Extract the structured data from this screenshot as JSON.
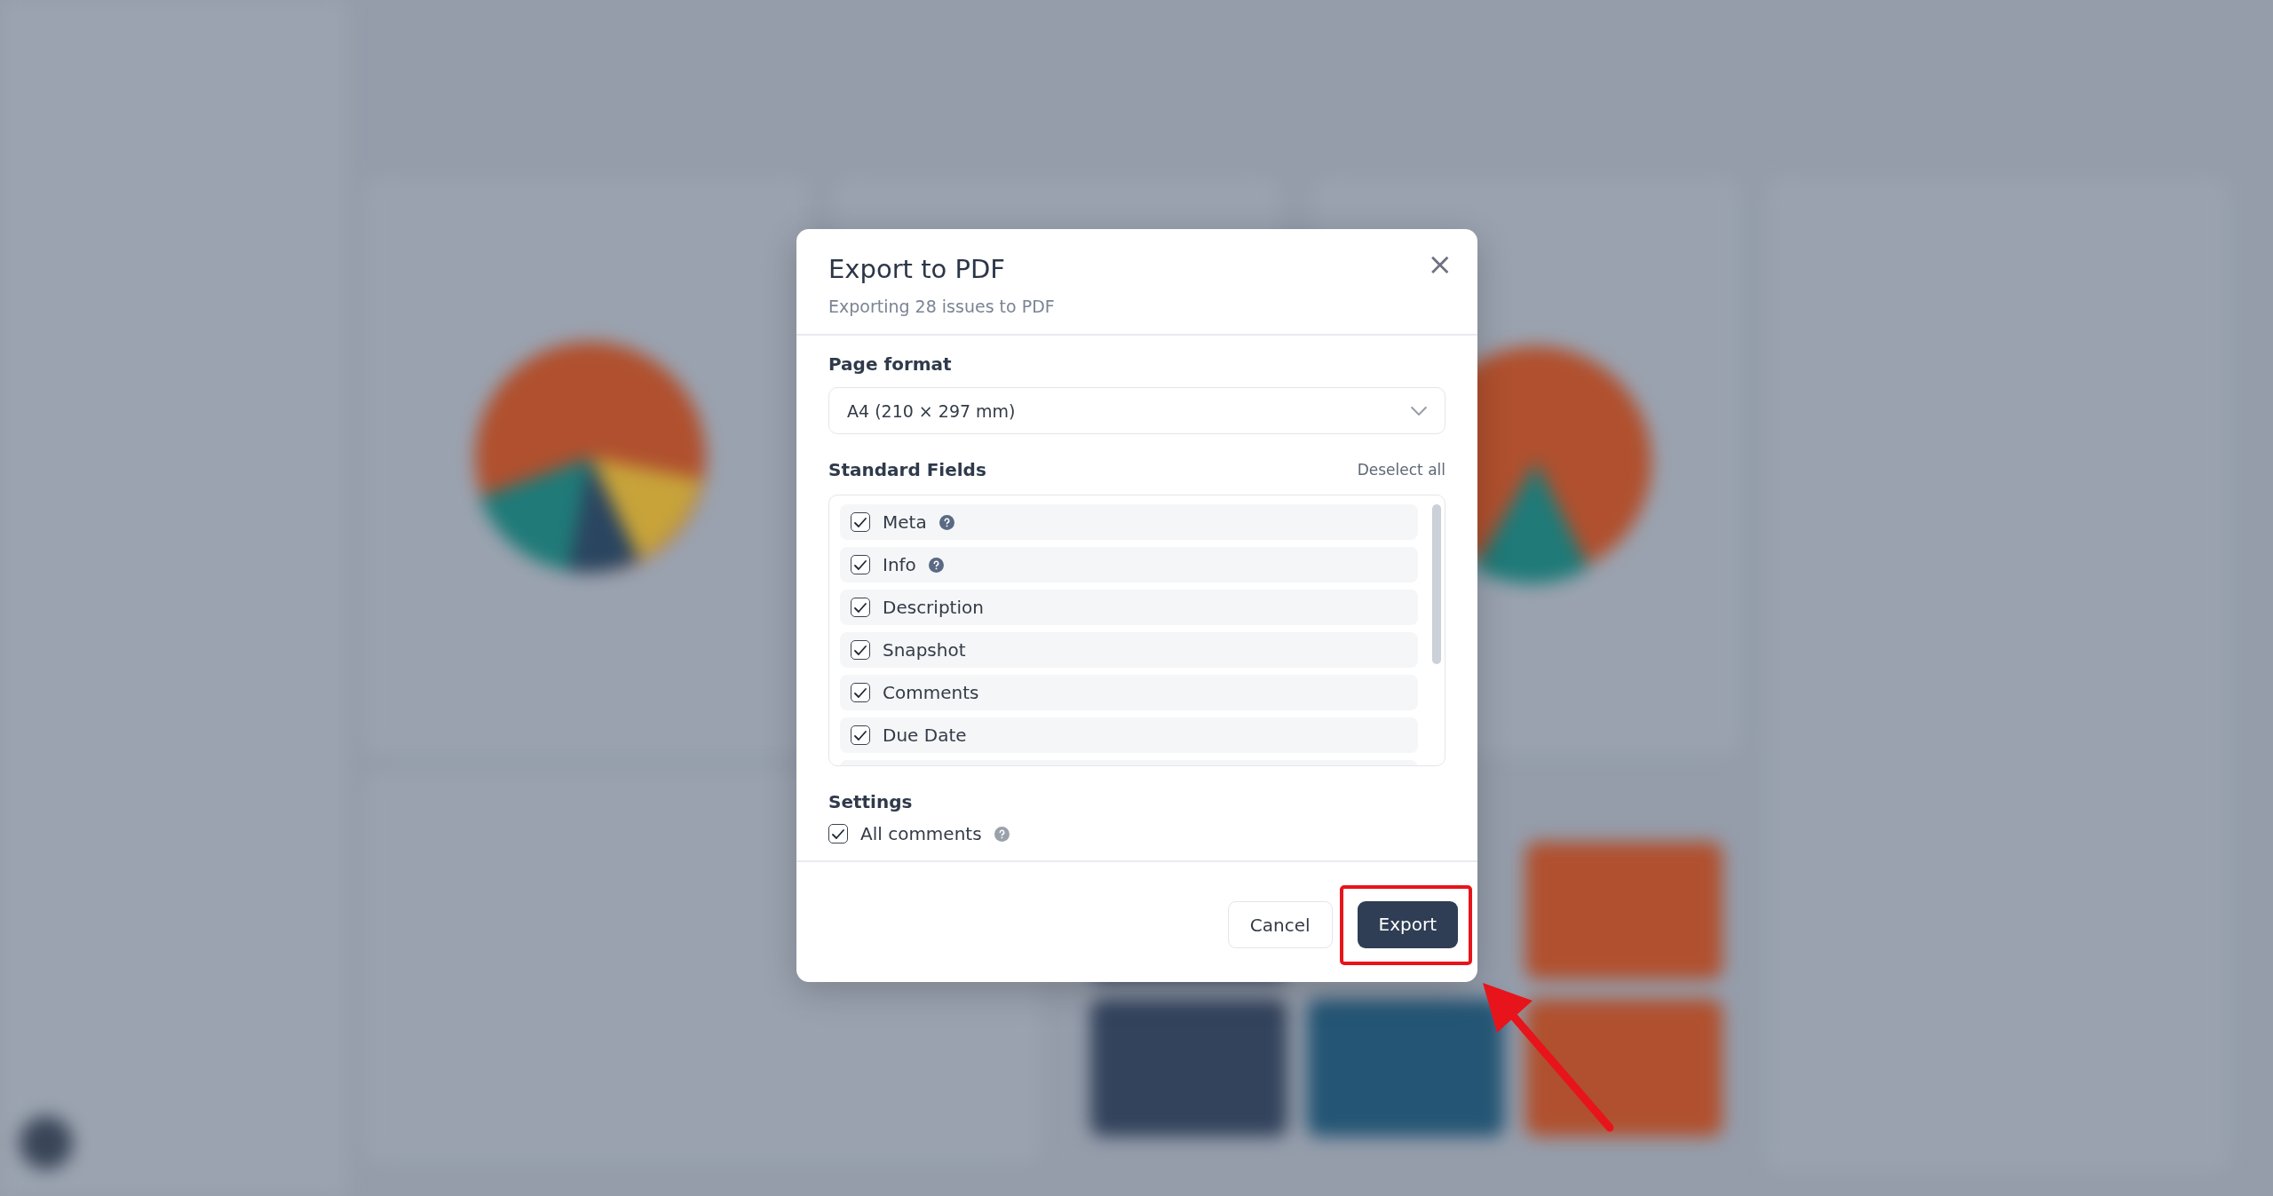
{
  "dialog": {
    "title": "Export to PDF",
    "subtitle": "Exporting 28 issues to PDF",
    "close_icon": "×",
    "page_format": {
      "label": "Page format",
      "value": "A4 (210 × 297 mm)"
    },
    "standard_fields": {
      "label": "Standard Fields",
      "action": "Deselect all",
      "items": [
        {
          "label": "Meta",
          "checked": true,
          "help": true
        },
        {
          "label": "Info",
          "checked": true,
          "help": true
        },
        {
          "label": "Description",
          "checked": true,
          "help": false
        },
        {
          "label": "Snapshot",
          "checked": true,
          "help": false
        },
        {
          "label": "Comments",
          "checked": true,
          "help": false
        },
        {
          "label": "Due Date",
          "checked": true,
          "help": false
        }
      ]
    },
    "settings": {
      "label": "Settings",
      "items": [
        {
          "label": "All comments",
          "checked": true,
          "help": true
        }
      ]
    },
    "buttons": [
      {
        "label": "Cancel",
        "kind": "secondary",
        "highlighted": false
      },
      {
        "label": "Export",
        "kind": "primary",
        "highlighted": true
      }
    ]
  }
}
